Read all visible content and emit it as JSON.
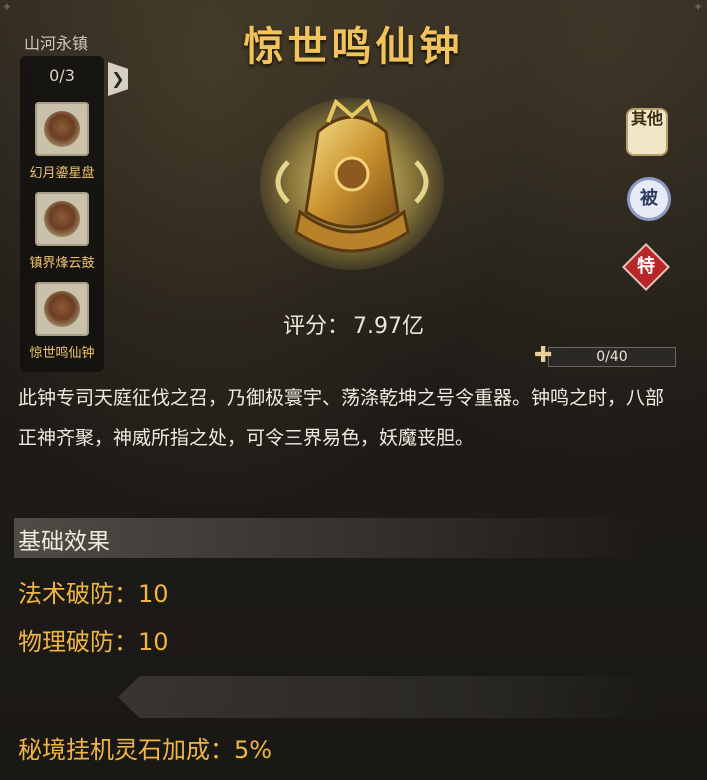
{
  "item": {
    "name": "惊世鸣仙钟",
    "score_label": "评分：",
    "score_value": "7.97亿",
    "description": "此钟专司天庭征伐之召，乃御极寰宇、荡涤乾坤之号令重器。钟鸣之时，八部正神齐聚，神威所指之处，可令三界易色，妖魔丧胆。"
  },
  "set": {
    "name": "山河永镇",
    "count": "0/3",
    "items": [
      {
        "label": "幻月鎏星盘",
        "icon": "star-disc-icon"
      },
      {
        "label": "镇界烽云鼓",
        "icon": "cloud-drum-icon"
      },
      {
        "label": "惊世鸣仙钟",
        "icon": "bell-icon"
      }
    ],
    "expand_glyph": "❯"
  },
  "side_buttons": {
    "other": "其他",
    "passive": "被",
    "special": "特"
  },
  "fragments": {
    "text": "0/40",
    "current": 0,
    "total": 40,
    "icon": "puzzle-icon"
  },
  "base_effects": {
    "title": "基础效果",
    "stats": [
      {
        "text": "法术破防：10"
      },
      {
        "text": "物理破防：10"
      }
    ]
  },
  "bonus": {
    "text": "秘境挂机灵石加成：5%"
  },
  "colors": {
    "title_gold": "#f1c35a",
    "stat_orange": "#efb545",
    "panel_bg": "#1e1b17"
  }
}
